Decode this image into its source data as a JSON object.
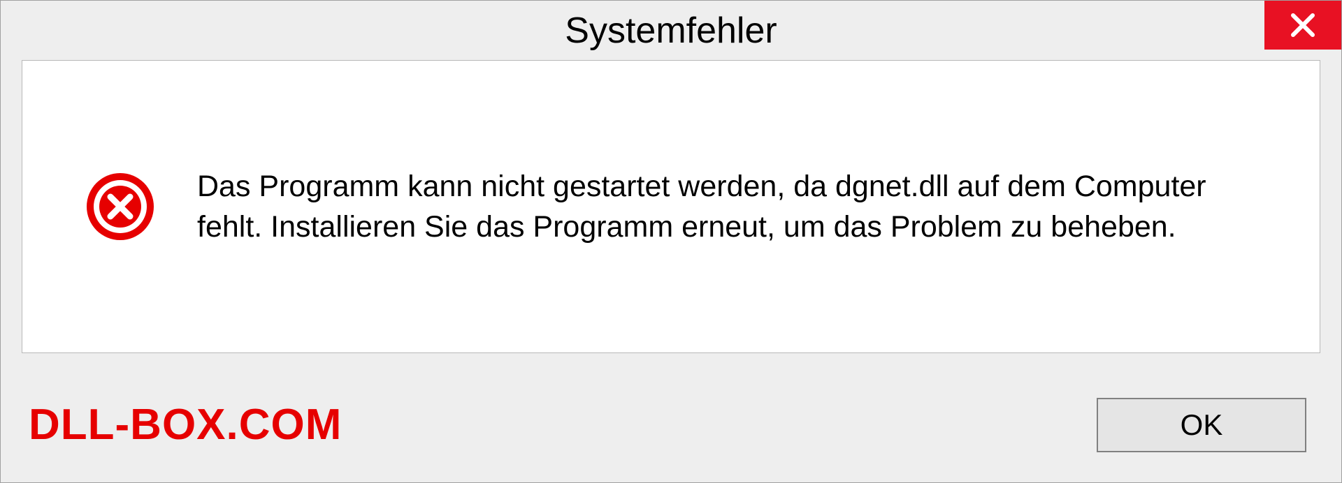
{
  "dialog": {
    "title": "Systemfehler",
    "message": "Das Programm kann nicht gestartet werden, da dgnet.dll auf dem Computer fehlt. Installieren Sie das Programm erneut, um das Problem zu beheben.",
    "ok_label": "OK"
  },
  "watermark": "DLL-BOX.COM"
}
